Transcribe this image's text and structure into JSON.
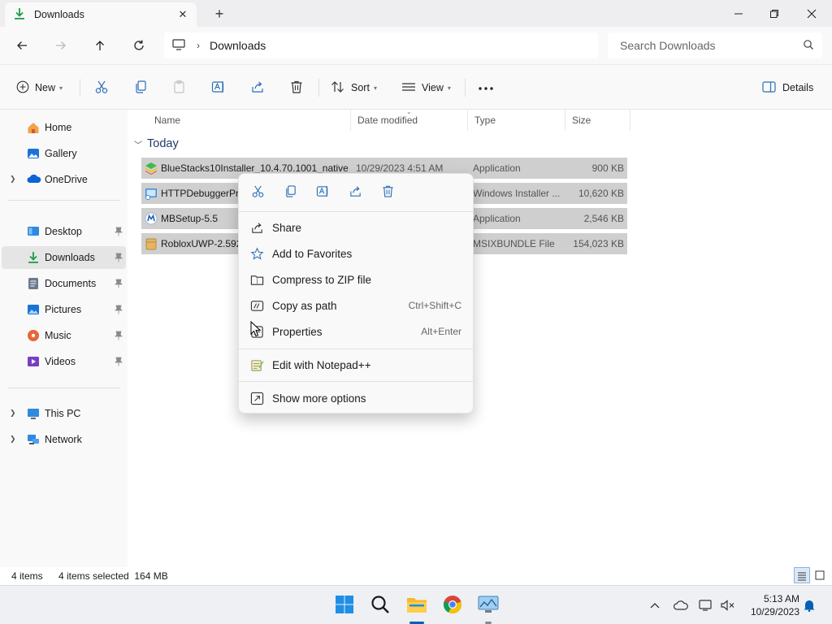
{
  "window": {
    "tab_title": "Downloads",
    "tab_icon": "download-arrow-icon",
    "new_tab_symbol": "+"
  },
  "address": {
    "location": "Downloads",
    "search_placeholder": "Search Downloads"
  },
  "toolbar": {
    "new_label": "New",
    "sort_label": "Sort",
    "view_label": "View",
    "details_label": "Details"
  },
  "sidebar": {
    "items": [
      {
        "label": "Home",
        "icon": "home-icon"
      },
      {
        "label": "Gallery",
        "icon": "gallery-icon"
      },
      {
        "label": "OneDrive",
        "icon": "onedrive-cloud-icon"
      },
      {
        "label": "Desktop",
        "icon": "desktop-icon",
        "pinned": true
      },
      {
        "label": "Downloads",
        "icon": "download-arrow-icon",
        "pinned": true,
        "selected": true
      },
      {
        "label": "Documents",
        "icon": "documents-icon",
        "pinned": true
      },
      {
        "label": "Pictures",
        "icon": "pictures-icon",
        "pinned": true
      },
      {
        "label": "Music",
        "icon": "music-icon",
        "pinned": true
      },
      {
        "label": "Videos",
        "icon": "videos-icon",
        "pinned": true
      },
      {
        "label": "This PC",
        "icon": "this-pc-icon"
      },
      {
        "label": "Network",
        "icon": "network-icon"
      }
    ]
  },
  "columns": {
    "name": "Name",
    "date": "Date modified",
    "type": "Type",
    "size": "Size"
  },
  "group": {
    "label": "Today"
  },
  "files": [
    {
      "name": "BlueStacks10Installer_10.4.70.1001_native...",
      "date": "10/29/2023 4:51 AM",
      "type": "Application",
      "size": "900 KB",
      "icon": "bluestacks-icon"
    },
    {
      "name": "HTTPDebuggerPr",
      "date": "",
      "type": "Windows Installer ...",
      "size": "10,620 KB",
      "icon": "installer-icon"
    },
    {
      "name": "MBSetup-5.5",
      "date": "",
      "type": "Application",
      "size": "2,546 KB",
      "icon": "malwarebytes-icon"
    },
    {
      "name": "RobloxUWP-2.592",
      "date": "",
      "type": "MSIXBUNDLE File",
      "size": "154,023 KB",
      "icon": "package-icon"
    }
  ],
  "context_menu": {
    "quick_actions": [
      "cut-icon",
      "copy-icon",
      "rename-icon",
      "share-icon",
      "delete-icon"
    ],
    "items": [
      {
        "label": "Share",
        "shortcut": "",
        "icon": "share-icon"
      },
      {
        "label": "Add to Favorites",
        "shortcut": "",
        "icon": "star-icon"
      },
      {
        "label": "Compress to ZIP file",
        "shortcut": "",
        "icon": "zip-icon"
      },
      {
        "label": "Copy as path",
        "shortcut": "Ctrl+Shift+C",
        "icon": "copy-path-icon"
      },
      {
        "label": "Properties",
        "shortcut": "Alt+Enter",
        "icon": "properties-icon"
      },
      {
        "label": "Edit with Notepad++",
        "shortcut": "",
        "icon": "notepadpp-icon"
      },
      {
        "label": "Show more options",
        "shortcut": "",
        "icon": "more-options-icon"
      }
    ]
  },
  "status": {
    "item_count": "4 items",
    "selection": "4 items selected  164 MB"
  },
  "taskbar": {
    "apps": [
      "windows-start-icon",
      "search-icon",
      "file-explorer-icon",
      "chrome-icon",
      "monitor-app-icon"
    ],
    "time": "5:13 AM",
    "date": "10/29/2023"
  },
  "colors": {
    "accent": "#005fb8",
    "selection_row": "#cfcfcf",
    "group_header": "#1f3b68"
  }
}
